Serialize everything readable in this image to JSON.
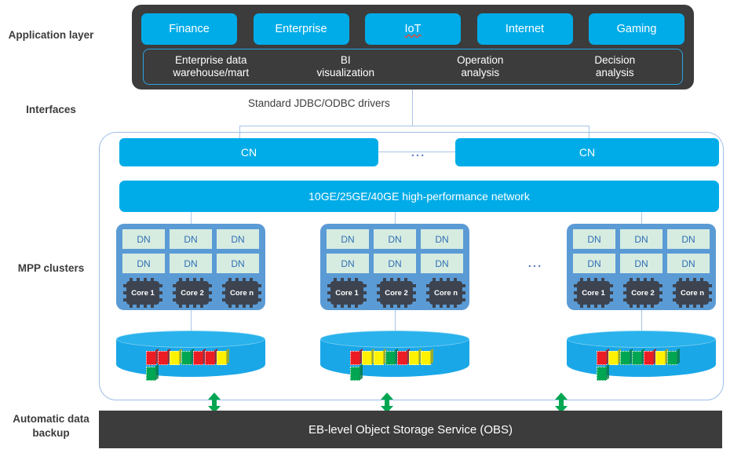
{
  "colors": {
    "accent_blue": "#00ace8",
    "dark_panel": "#3c3c3c",
    "node_group_blue": "#5b9bd5",
    "dn_green": "#d7ece0",
    "chip_gray": "#3d4450",
    "cylinder_blue": "#1aa7e8",
    "arrow_green": "#00a651",
    "container_border": "#9dbde8",
    "spellcheck_red": "#e8493a"
  },
  "row_labels": [
    {
      "id": "application-layer",
      "text": "Application layer"
    },
    {
      "id": "interfaces",
      "text": "Interfaces"
    },
    {
      "id": "mpp-clusters",
      "text": "MPP clusters"
    },
    {
      "id": "automatic-data-backup",
      "text": "Automatic data backup"
    }
  ],
  "application_layer": {
    "domains": [
      {
        "label": "Finance",
        "spellcheck_underline": false
      },
      {
        "label": "Enterprise",
        "spellcheck_underline": false
      },
      {
        "label": "IoT",
        "spellcheck_underline": true
      },
      {
        "label": "Internet",
        "spellcheck_underline": false
      },
      {
        "label": "Gaming",
        "spellcheck_underline": false
      }
    ],
    "functions": [
      {
        "line1": "Enterprise data",
        "line2": "warehouse/mart"
      },
      {
        "line1": "BI",
        "line2": "visualization"
      },
      {
        "line1": "Operation",
        "line2": "analysis"
      },
      {
        "line1": "Decision",
        "line2": "analysis"
      }
    ]
  },
  "interfaces": {
    "driver_text": "Standard JDBC/ODBC drivers"
  },
  "mpp": {
    "coordinator_nodes": [
      {
        "label": "CN"
      },
      {
        "label": "CN"
      }
    ],
    "cn_ellipsis": "...",
    "network_label": "10GE/25GE/40GE high-performance network",
    "group_ellipsis": "...",
    "node_groups": [
      {
        "id": "group-1",
        "dn_labels": [
          "DN",
          "DN",
          "DN",
          "DN",
          "DN",
          "DN"
        ],
        "cores": [
          "Core 1",
          "Core 2",
          "Core n"
        ],
        "storage_blocks": [
          "#ed1c24",
          "#ed1c24",
          "#fff200",
          "#00a651",
          "#ed1c24",
          "#ed1c24",
          "#fff200",
          "#00a651"
        ]
      },
      {
        "id": "group-2",
        "dn_labels": [
          "DN",
          "DN",
          "DN",
          "DN",
          "DN",
          "DN"
        ],
        "cores": [
          "Core 1",
          "Core 2",
          "Core n"
        ],
        "storage_blocks": [
          "#ed1c24",
          "#fff200",
          "#fff200",
          "#00a651",
          "#ed1c24",
          "#fff200",
          "#fff200",
          "#00a651"
        ]
      },
      {
        "id": "group-3",
        "dn_labels": [
          "DN",
          "DN",
          "DN",
          "DN",
          "DN",
          "DN"
        ],
        "cores": [
          "Core 1",
          "Core 2",
          "Core n"
        ],
        "storage_blocks": [
          "#ed1c24",
          "#fff200",
          "#00a651",
          "#00a651",
          "#ed1c24",
          "#fff200",
          "#00a651",
          "#00a651"
        ]
      }
    ]
  },
  "backup": {
    "obs_label": "EB-level Object Storage Service (OBS)",
    "arrow_icon": "double-headed-vertical-arrow",
    "arrow_count": 3
  }
}
